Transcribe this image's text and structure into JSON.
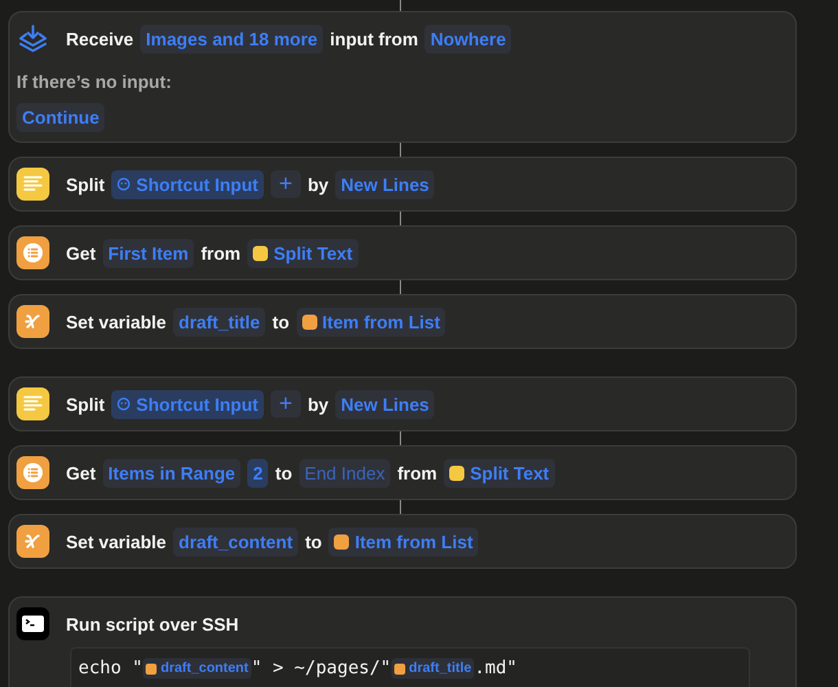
{
  "actions": [
    {
      "kind": "receive",
      "connected": true,
      "parts": [
        {
          "kind": "word",
          "text": "Receive"
        },
        {
          "kind": "param",
          "text": "Images and 18 more"
        },
        {
          "kind": "word",
          "text": "input from"
        },
        {
          "kind": "param",
          "text": "Nowhere"
        }
      ],
      "fallback": {
        "label": "If there’s no input:",
        "value": "Continue"
      }
    },
    {
      "kind": "text",
      "connected": true,
      "parts": [
        {
          "kind": "word",
          "text": "Split"
        },
        {
          "kind": "input",
          "text": "Shortcut Input"
        },
        {
          "kind": "add",
          "text": "+"
        },
        {
          "kind": "word",
          "text": "by"
        },
        {
          "kind": "param",
          "text": "New Lines"
        }
      ]
    },
    {
      "kind": "list",
      "connected": true,
      "parts": [
        {
          "kind": "word",
          "text": "Get"
        },
        {
          "kind": "param",
          "text": "First Item"
        },
        {
          "kind": "word",
          "text": "from"
        },
        {
          "kind": "variable",
          "text": "Split Text",
          "color": "#f5c842"
        }
      ]
    },
    {
      "kind": "variable",
      "connected": true,
      "parts": [
        {
          "kind": "word",
          "text": "Set variable"
        },
        {
          "kind": "param",
          "text": "draft_title"
        },
        {
          "kind": "word",
          "text": "to"
        },
        {
          "kind": "variable",
          "text": "Item from List",
          "color": "#f0a040"
        }
      ]
    },
    {
      "kind": "text",
      "connected": false,
      "parts": [
        {
          "kind": "word",
          "text": "Split"
        },
        {
          "kind": "input",
          "text": "Shortcut Input"
        },
        {
          "kind": "add",
          "text": "+"
        },
        {
          "kind": "word",
          "text": "by"
        },
        {
          "kind": "param",
          "text": "New Lines"
        }
      ]
    },
    {
      "kind": "list",
      "connected": true,
      "parts": [
        {
          "kind": "word",
          "text": "Get"
        },
        {
          "kind": "param",
          "text": "Items in Range"
        },
        {
          "kind": "number",
          "text": "2"
        },
        {
          "kind": "word",
          "text": "to"
        },
        {
          "kind": "placeholder",
          "text": "End Index"
        },
        {
          "kind": "word",
          "text": "from"
        },
        {
          "kind": "variable",
          "text": "Split Text",
          "color": "#f5c842"
        }
      ]
    },
    {
      "kind": "variable",
      "connected": true,
      "parts": [
        {
          "kind": "word",
          "text": "Set variable"
        },
        {
          "kind": "param",
          "text": "draft_content"
        },
        {
          "kind": "word",
          "text": "to"
        },
        {
          "kind": "variable",
          "text": "Item from List",
          "color": "#f0a040"
        }
      ]
    },
    {
      "kind": "terminal",
      "connected": false,
      "parts": [
        {
          "kind": "word",
          "text": "Run script over SSH"
        }
      ],
      "script": [
        {
          "kind": "code",
          "text": "echo \""
        },
        {
          "kind": "variable",
          "text": "draft_content",
          "color": "#f0a040"
        },
        {
          "kind": "code",
          "text": "\" > ~/pages/\""
        },
        {
          "kind": "variable",
          "text": "draft_title",
          "color": "#f0a040"
        },
        {
          "kind": "code",
          "text": ".md\""
        }
      ]
    }
  ]
}
